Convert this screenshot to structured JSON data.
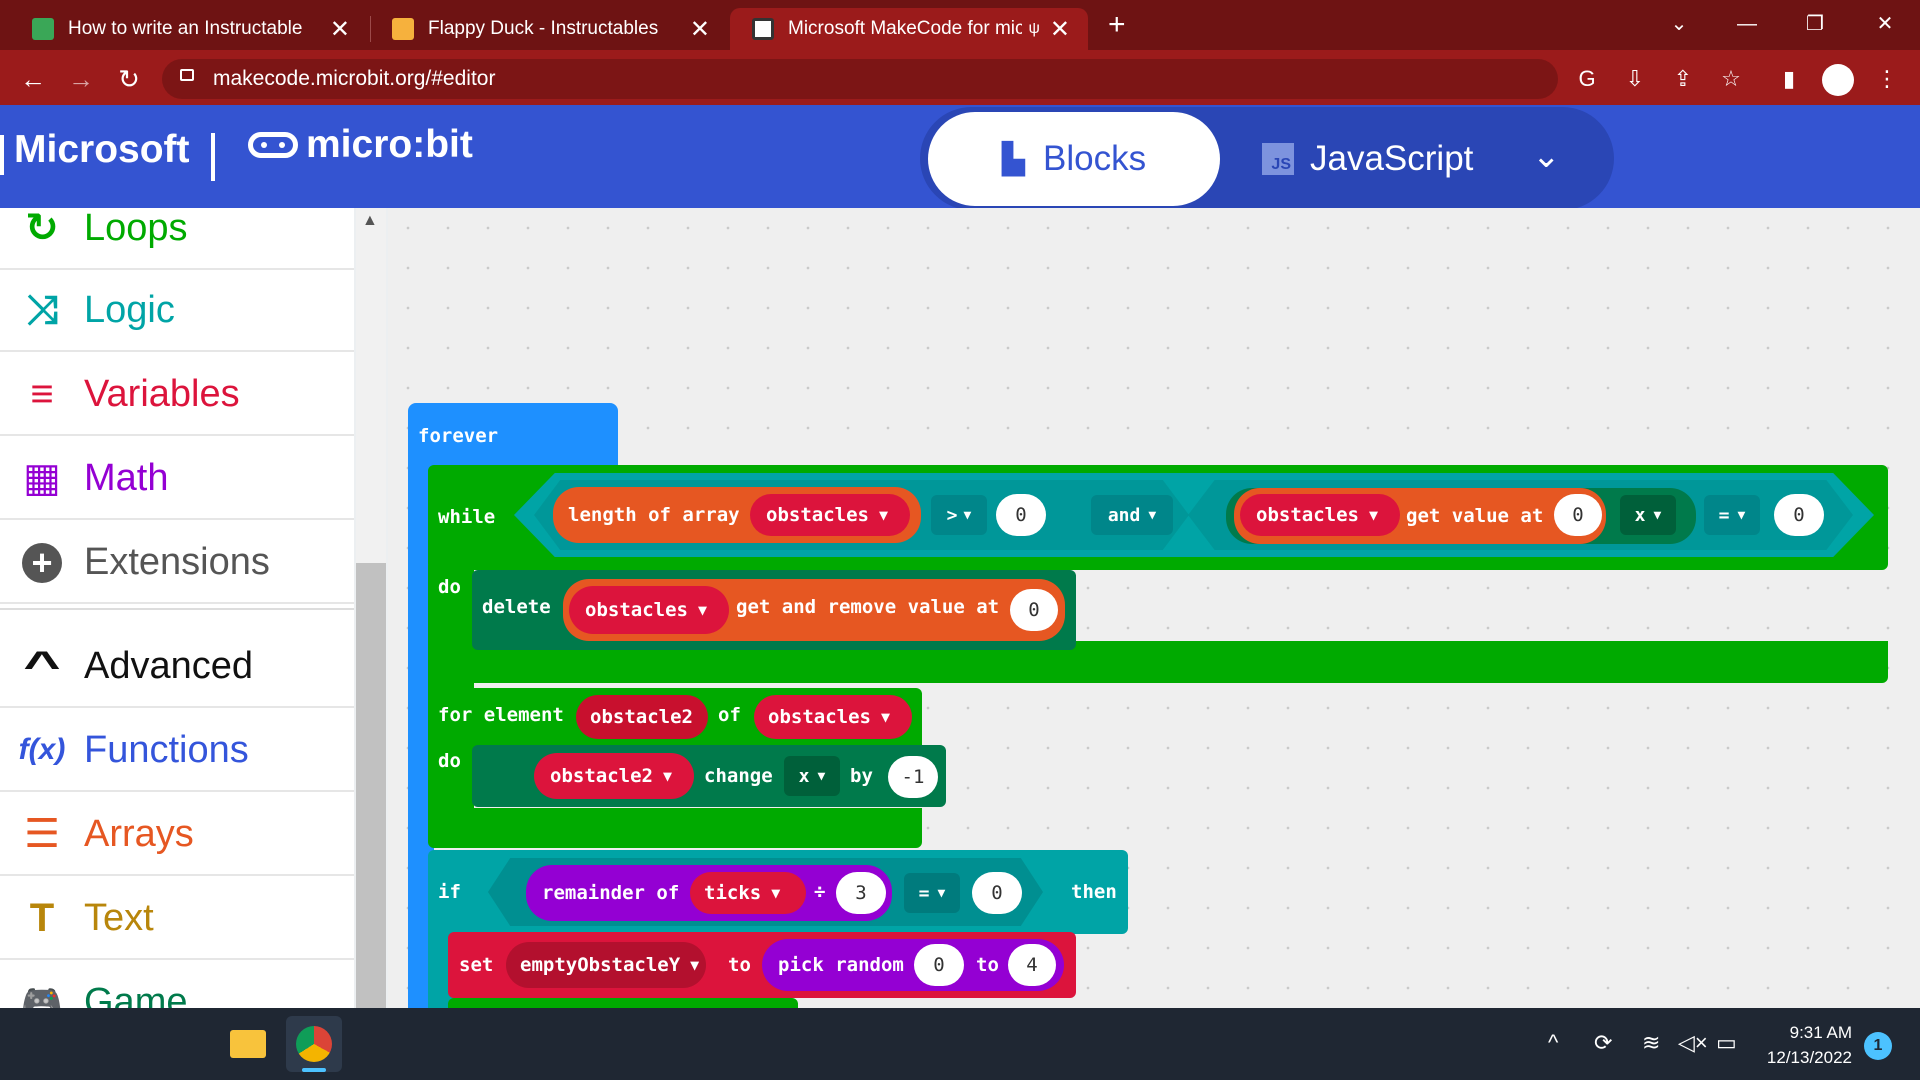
{
  "browser": {
    "tabs": [
      {
        "title": "How to write an Instructable",
        "close": "✕",
        "favicon_color": "#3aa757"
      },
      {
        "title": "Flappy Duck - Instructables",
        "close": "✕",
        "favicon_color": "#f6b13d"
      },
      {
        "title": "Microsoft MakeCode for micro:bit",
        "close": "✕",
        "favicon_color": "#ffffff"
      }
    ],
    "new_tab": "+",
    "url": "makecode.microbit.org/#editor",
    "colors": {
      "titlebar": "#6e1313",
      "toolbar": "#9b1b1b"
    }
  },
  "header": {
    "microsoft": "Microsoft",
    "microbit": "micro:bit",
    "blocks_label": "Blocks",
    "js_label": "JavaScript",
    "js_badge": "JS",
    "color": "#3454d1"
  },
  "toolbox": {
    "items": [
      {
        "label": "Loops",
        "icon": "loops-icon",
        "glyph": "↻",
        "color": "#00aa00"
      },
      {
        "label": "Logic",
        "icon": "logic-shuffle-icon",
        "glyph": "⤨",
        "color": "#00a4a6"
      },
      {
        "label": "Variables",
        "icon": "variables-icon",
        "glyph": "≡",
        "color": "#dc143c"
      },
      {
        "label": "Math",
        "icon": "calculator-icon",
        "glyph": "▦",
        "color": "#9400d3"
      },
      {
        "label": "Extensions",
        "icon": "plus-circle-icon",
        "glyph": "+",
        "color": "#555555"
      },
      {
        "label": "Advanced",
        "icon": "chevron-up-icon",
        "glyph": "^",
        "color": "#111111"
      },
      {
        "label": "Functions",
        "icon": "function-icon",
        "glyph": "f(x)",
        "color": "#3455db"
      },
      {
        "label": "Arrays",
        "icon": "list-icon",
        "glyph": "☰",
        "color": "#e65722"
      },
      {
        "label": "Text",
        "icon": "text-icon",
        "glyph": "T",
        "color": "#b8860b"
      },
      {
        "label": "Game",
        "icon": "gamepad-icon",
        "glyph": "🎮",
        "color": "#007a4b"
      }
    ]
  },
  "blocks": {
    "forever": "forever",
    "while": "while",
    "do": "do",
    "length_of_array": "length of array",
    "obstacles": "obstacles",
    "gt": ">",
    "zero": "0",
    "and": "and",
    "get_value_at": "get value at",
    "x": "x",
    "eq": "=",
    "delete": "delete",
    "get_and_remove": "get and remove value at",
    "for_element": "for element",
    "obstacle2": "obstacle2",
    "of": "of",
    "change": "change",
    "by": "by",
    "minus_one": "-1",
    "if": "if",
    "remainder_of": "remainder of",
    "ticks": "ticks",
    "div": "÷",
    "three": "3",
    "then": "then",
    "set": "set",
    "emptyObstacleY": "emptyObstacleY",
    "to": "to",
    "pick_random": "pick random",
    "four": "4",
    "colors": {
      "loops": "#00aa00",
      "forever": "#1e90ff",
      "logic": "#00a4a6",
      "variables": "#dc143c",
      "arrays": "#e65722",
      "math": "#9400d3",
      "sprite": "#007a4b"
    }
  },
  "taskbar": {
    "time": "9:31 AM",
    "date": "12/13/2022",
    "notifications": "1"
  }
}
